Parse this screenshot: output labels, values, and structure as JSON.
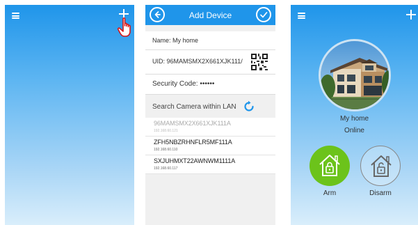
{
  "screen1": {
    "menu_icon": "hamburger-icon",
    "add_icon": "plus-icon",
    "pointer_icon": "hand-pointer-icon"
  },
  "screen2": {
    "header": {
      "title": "Add Device",
      "back_icon": "back-arrow-icon",
      "confirm_icon": "checkmark-icon"
    },
    "form": {
      "name": "Name:  My home",
      "uid": "UID:  96MAMSMX2X661XJK111/",
      "security": "Security Code:  ••••••"
    },
    "search": {
      "label": "Search Camera within LAN",
      "refresh_icon": "refresh-icon"
    },
    "cameras": [
      {
        "uid": "96MAMSMX2X661XJK111A",
        "ip": "192.168.60.121",
        "dimmed": true
      },
      {
        "uid": "ZFH5NBZRHNFLR5MF111A",
        "ip": "192.168.60.110",
        "dimmed": false
      },
      {
        "uid": "SXJUHMXT22AWNWM1111A",
        "ip": "192.168.60.117",
        "dimmed": false
      }
    ]
  },
  "screen3": {
    "home_name": "My home",
    "status": "Online",
    "arm_label": "Arm",
    "disarm_label": "Disarm"
  },
  "colors": {
    "header_blue": "#1f95ea",
    "arm_green": "#6cc31b"
  }
}
